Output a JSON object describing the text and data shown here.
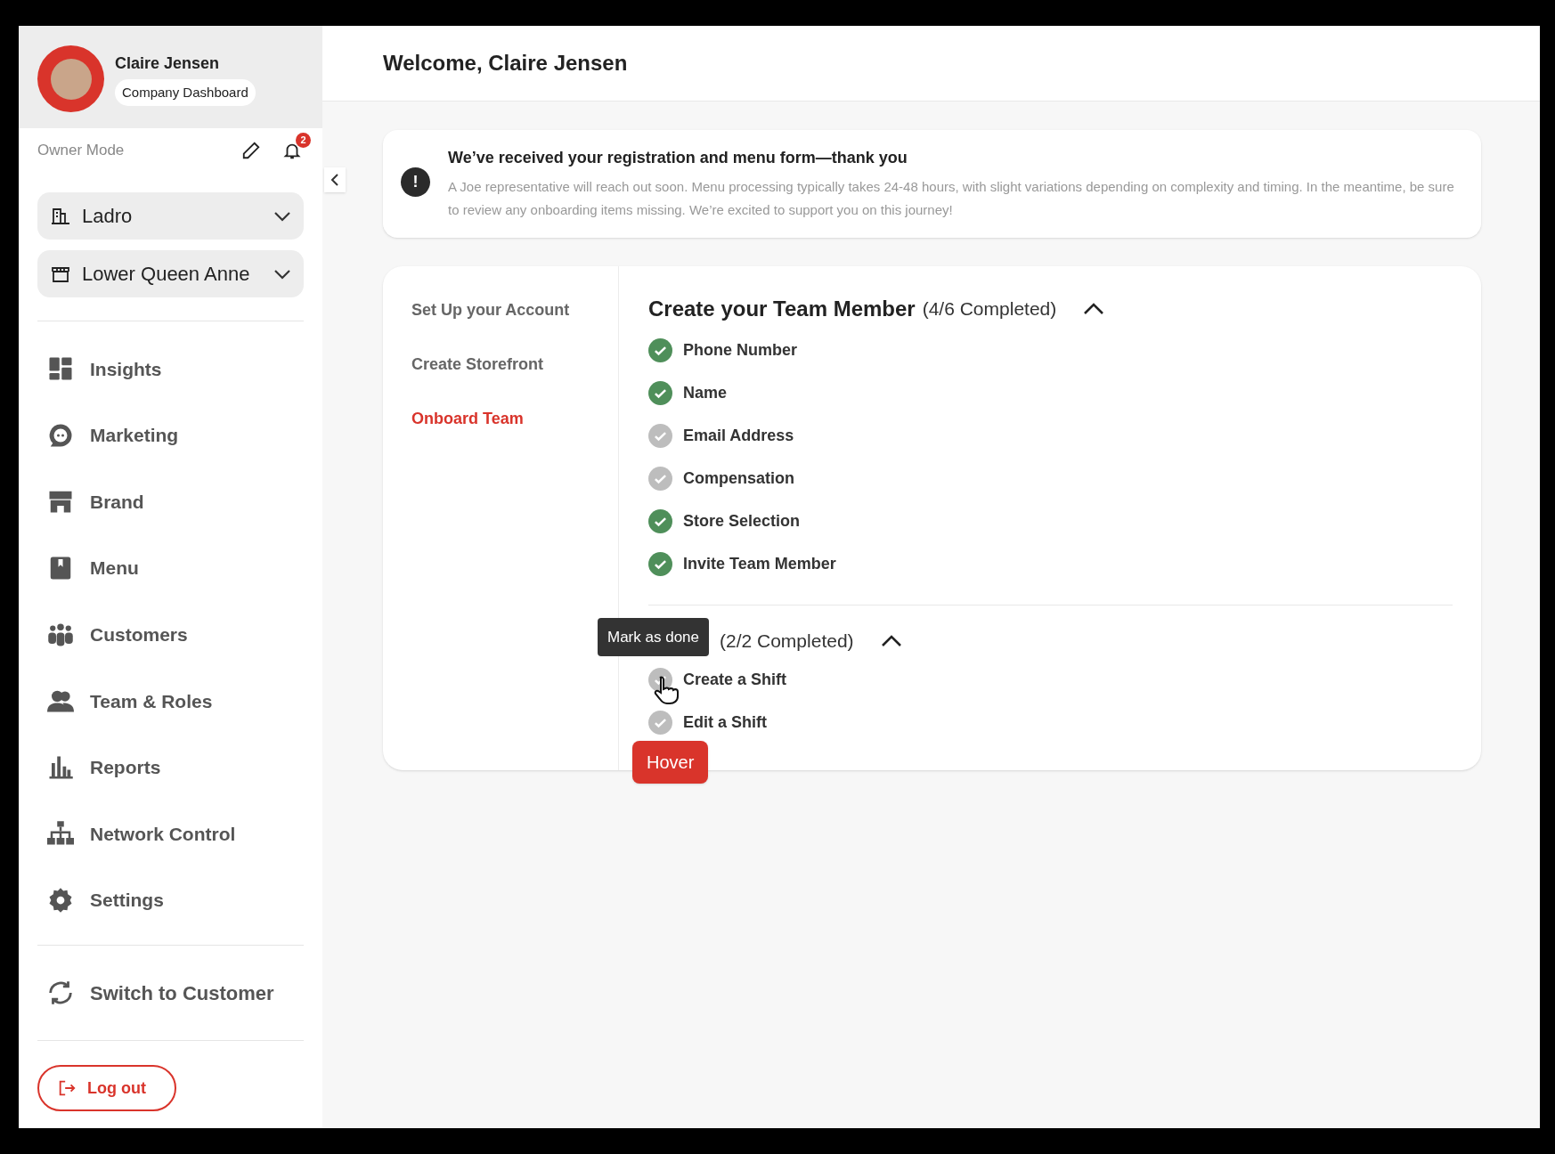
{
  "user": {
    "name": "Claire Jensen",
    "badge": "Company Dashboard",
    "mode": "Owner Mode",
    "notifications": "2"
  },
  "selectors": [
    {
      "kind": "building",
      "label": "Ladro"
    },
    {
      "kind": "store",
      "label": "Lower Queen Anne"
    }
  ],
  "nav": [
    {
      "kind": "insights",
      "label": "Insights"
    },
    {
      "kind": "marketing",
      "label": "Marketing"
    },
    {
      "kind": "brand",
      "label": "Brand"
    },
    {
      "kind": "menu",
      "label": "Menu"
    },
    {
      "kind": "customers",
      "label": "Customers"
    },
    {
      "kind": "team",
      "label": "Team & Roles"
    },
    {
      "kind": "reports",
      "label": "Reports"
    },
    {
      "kind": "network",
      "label": "Network Control"
    },
    {
      "kind": "settings",
      "label": "Settings"
    }
  ],
  "switch_label": "Switch to Customer",
  "logout_label": "Log out",
  "header": {
    "title": "Welcome, Claire Jensen"
  },
  "notice": {
    "icon": "!",
    "title": "We’ve received your registration and menu form—thank you",
    "body": "A Joe representative will reach out soon. Menu processing typically takes 24-48 hours, with slight variations depending on complexity and timing. In the meantime, be sure to review any onboarding items missing. We’re excited to support you on this journey!"
  },
  "steps": [
    {
      "label": "Set Up your Account",
      "selected": false
    },
    {
      "label": "Create Storefront",
      "selected": false
    },
    {
      "label": "Onboard Team",
      "selected": true
    }
  ],
  "sections": [
    {
      "title": "Create your Team Member",
      "progress": "(4/6 Completed)",
      "expanded": true,
      "tasks": [
        {
          "label": "Phone Number",
          "done": true
        },
        {
          "label": "Name",
          "done": true
        },
        {
          "label": "Email Address",
          "done": false
        },
        {
          "label": "Compensation",
          "done": false
        },
        {
          "label": "Store Selection",
          "done": true
        },
        {
          "label": "Invite Team Member",
          "done": true
        }
      ]
    },
    {
      "progress": "(2/2 Completed)",
      "expanded": true,
      "tasks": [
        {
          "label": "Create a Shift",
          "done": false
        },
        {
          "label": "Edit a Shift",
          "done": false
        }
      ]
    }
  ],
  "tooltip": "Mark as done",
  "hover_tag": "Hover"
}
